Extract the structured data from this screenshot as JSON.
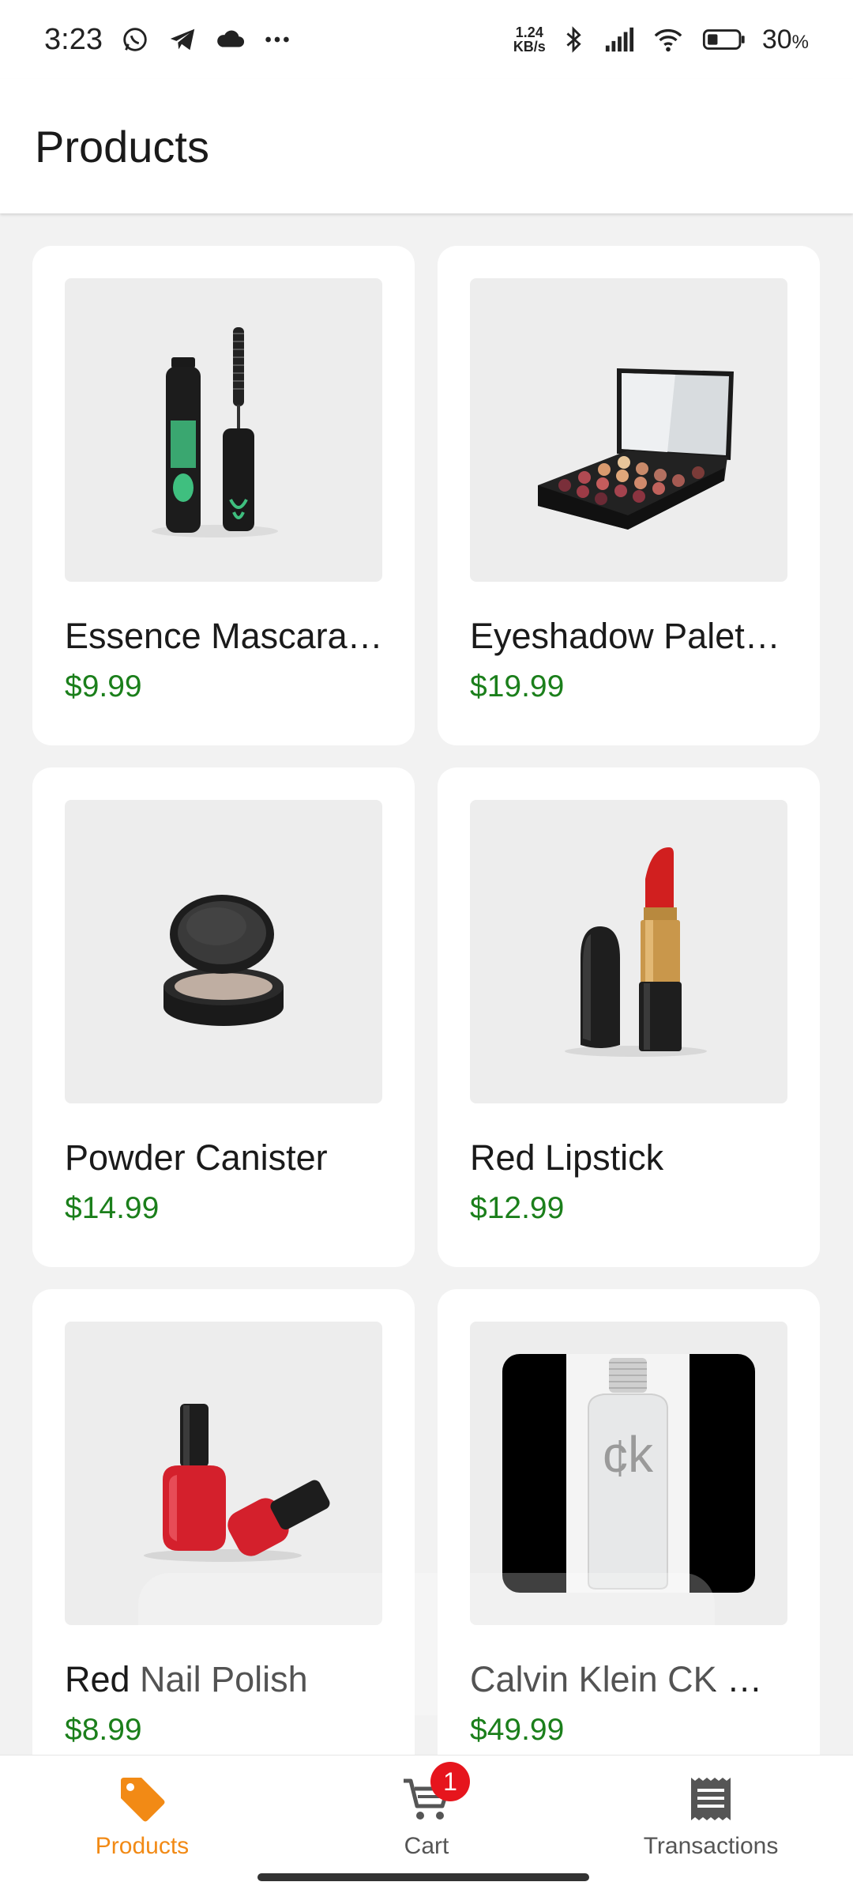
{
  "status_bar": {
    "time": "3:23",
    "net_speed_value": "1.24",
    "net_speed_unit": "KB/s",
    "battery_percent": "30",
    "percent_sign": "%",
    "icons": [
      "whatsapp-icon",
      "telegram-icon",
      "cloud-icon",
      "more-icon",
      "bluetooth-icon",
      "signal-icon",
      "wifi-icon",
      "battery-icon"
    ]
  },
  "app_bar": {
    "title": "Products"
  },
  "products": [
    {
      "name": "Essence Mascara…",
      "price": "$9.99",
      "image_icon": "mascara-image"
    },
    {
      "name": "Eyeshadow Palet…",
      "price": "$19.99",
      "image_icon": "eyeshadow-palette-image"
    },
    {
      "name": "Powder Canister",
      "price": "$14.99",
      "image_icon": "powder-canister-image"
    },
    {
      "name": "Red Lipstick",
      "price": "$12.99",
      "image_icon": "lipstick-image"
    },
    {
      "name": "Red Nail Polish",
      "price": "$8.99",
      "image_icon": "nail-polish-image"
    },
    {
      "name": "Calvin Klein CK …",
      "price": "$49.99",
      "image_icon": "perfume-bottle-image"
    }
  ],
  "bottom_nav": {
    "items": [
      {
        "label": "Products",
        "icon": "tag-icon",
        "active": true
      },
      {
        "label": "Cart",
        "icon": "cart-icon",
        "badge": "1"
      },
      {
        "label": "Transactions",
        "icon": "receipt-icon"
      }
    ]
  },
  "colors": {
    "accent": "#f28a15",
    "price": "#1b7f1b",
    "badge": "#e6151d"
  }
}
